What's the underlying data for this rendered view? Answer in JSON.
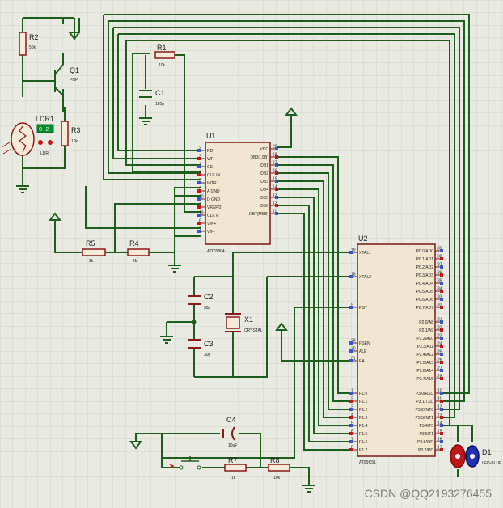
{
  "components": {
    "r2": {
      "ref": "R2",
      "value": "50k"
    },
    "q1": {
      "ref": "Q1",
      "value": "PNP"
    },
    "ldr1": {
      "ref": "LDR1",
      "value": "LDR",
      "display": "0.2"
    },
    "r3": {
      "ref": "R3",
      "value": "10k"
    },
    "r1": {
      "ref": "R1",
      "value": "10k"
    },
    "c1": {
      "ref": "C1",
      "value": "150p"
    },
    "u1": {
      "ref": "U1",
      "part": "ADC0804",
      "left_pins": [
        "RD",
        "WR",
        "CS",
        "CLK IN",
        "INTR",
        "A GND",
        "D GND",
        "VREF/2",
        "CLK R",
        "VIN+",
        "VIN-"
      ],
      "left_nums": [
        "2",
        "3",
        "1",
        "4",
        "5",
        "8",
        "10",
        "9",
        "19",
        "6",
        "7"
      ],
      "right_pins": [
        "VCC",
        "DB0(LSB)",
        "DB1",
        "DB2",
        "DB3",
        "DB4",
        "DB5",
        "DB6",
        "DB7(MSB)"
      ],
      "right_nums": [
        "20",
        "18",
        "17",
        "16",
        "15",
        "14",
        "13",
        "12",
        "11"
      ]
    },
    "r5": {
      "ref": "R5",
      "value": "2k"
    },
    "r4": {
      "ref": "R4",
      "value": "2k"
    },
    "c2": {
      "ref": "C2",
      "value": "30p"
    },
    "c3": {
      "ref": "C3",
      "value": "30p"
    },
    "x1": {
      "ref": "X1",
      "value": "CRYSTAL"
    },
    "u2": {
      "ref": "U2",
      "part": "AT89C51",
      "left_top": [
        "XTAL1",
        "XTAL2",
        "RST",
        "PSEN",
        "ALE",
        "EA"
      ],
      "left_top_nums": [
        "19",
        "18",
        "9",
        "29",
        "30",
        "31"
      ],
      "left_bot": [
        "P1.0",
        "P1.1",
        "P1.2",
        "P1.3",
        "P1.4",
        "P1.5",
        "P1.6",
        "P1.7"
      ],
      "left_bot_nums": [
        "1",
        "2",
        "3",
        "4",
        "5",
        "6",
        "7",
        "8"
      ],
      "right_p0": [
        "P0.0/AD0",
        "P0.1/AD1",
        "P0.2/AD2",
        "P0.3/AD3",
        "P0.4/AD4",
        "P0.5/AD5",
        "P0.6/AD6",
        "P0.7/AD7"
      ],
      "right_p0_nums": [
        "39",
        "38",
        "37",
        "36",
        "35",
        "34",
        "33",
        "32"
      ],
      "right_p2": [
        "P2.0/A8",
        "P2.1/A9",
        "P2.2/A10",
        "P2.3/A11",
        "P2.4/A12",
        "P2.5/A13",
        "P2.6/A14",
        "P2.7/A15"
      ],
      "right_p2_nums": [
        "21",
        "22",
        "23",
        "24",
        "25",
        "26",
        "27",
        "28"
      ],
      "right_p3": [
        "P3.0/RXD",
        "P3.1/TXD",
        "P3.2/INT0",
        "P3.3/INT1",
        "P3.4/T0",
        "P3.5/T1",
        "P3.6/WR",
        "P3.7/RD"
      ],
      "right_p3_nums": [
        "10",
        "11",
        "12",
        "13",
        "14",
        "15",
        "16",
        "17"
      ]
    },
    "c4": {
      "ref": "C4",
      "value": "10uF"
    },
    "r7": {
      "ref": "R7",
      "value": "1k"
    },
    "r8": {
      "ref": "R8",
      "value": "10k"
    },
    "d1": {
      "ref": "D1",
      "value": "LED-BLUE"
    }
  },
  "watermark": "CSDN @QQ2193276455",
  "colors": {
    "wire": "#1d5e1d",
    "body": "#8b1a1a",
    "grid": "#e9ebe3",
    "gridline": "#d3d6cc"
  }
}
